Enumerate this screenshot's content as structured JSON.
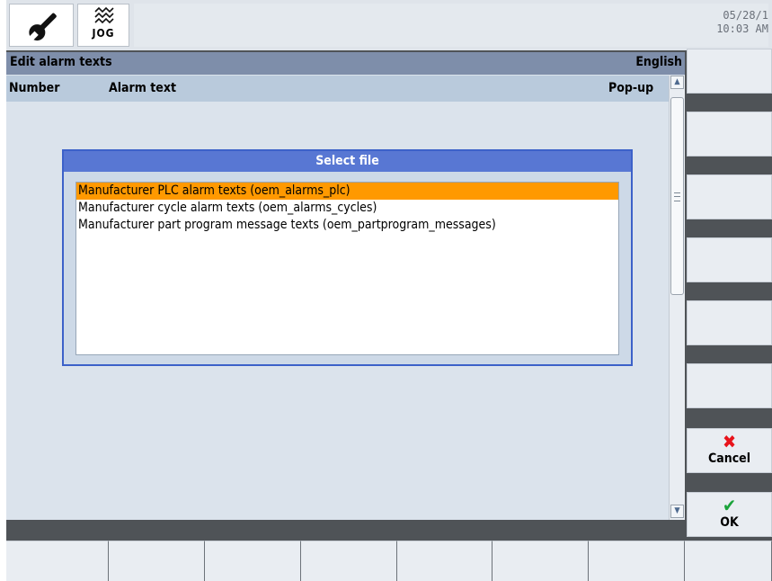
{
  "header": {
    "mode_label": "JOG",
    "date": "05/28/1",
    "time": "10:03 AM"
  },
  "window": {
    "title": "Edit alarm texts",
    "language": "English"
  },
  "columns": {
    "number": "Number",
    "alarm_text": "Alarm text",
    "popup": "Pop-up"
  },
  "dialog": {
    "title": "Select file",
    "items": [
      {
        "label": "Manufacturer PLC alarm texts (oem_alarms_plc)",
        "selected": true
      },
      {
        "label": "Manufacturer cycle alarm texts (oem_alarms_cycles)",
        "selected": false
      },
      {
        "label": "Manufacturer part program message texts (oem_partprogram_messages)",
        "selected": false
      }
    ]
  },
  "softkeys": {
    "cancel_label": "Cancel",
    "ok_label": "OK"
  },
  "colors": {
    "selection": "#ff9900",
    "dialog_title": "#5877d3",
    "title_bar": "#7e8eaa",
    "cancel_icon": "#e8131b",
    "ok_icon": "#1aa33a"
  },
  "icons": {
    "settings": "wrench-icon",
    "mode": "jog-mode-icon",
    "cancel": "x-icon",
    "ok": "checkmark-icon"
  }
}
